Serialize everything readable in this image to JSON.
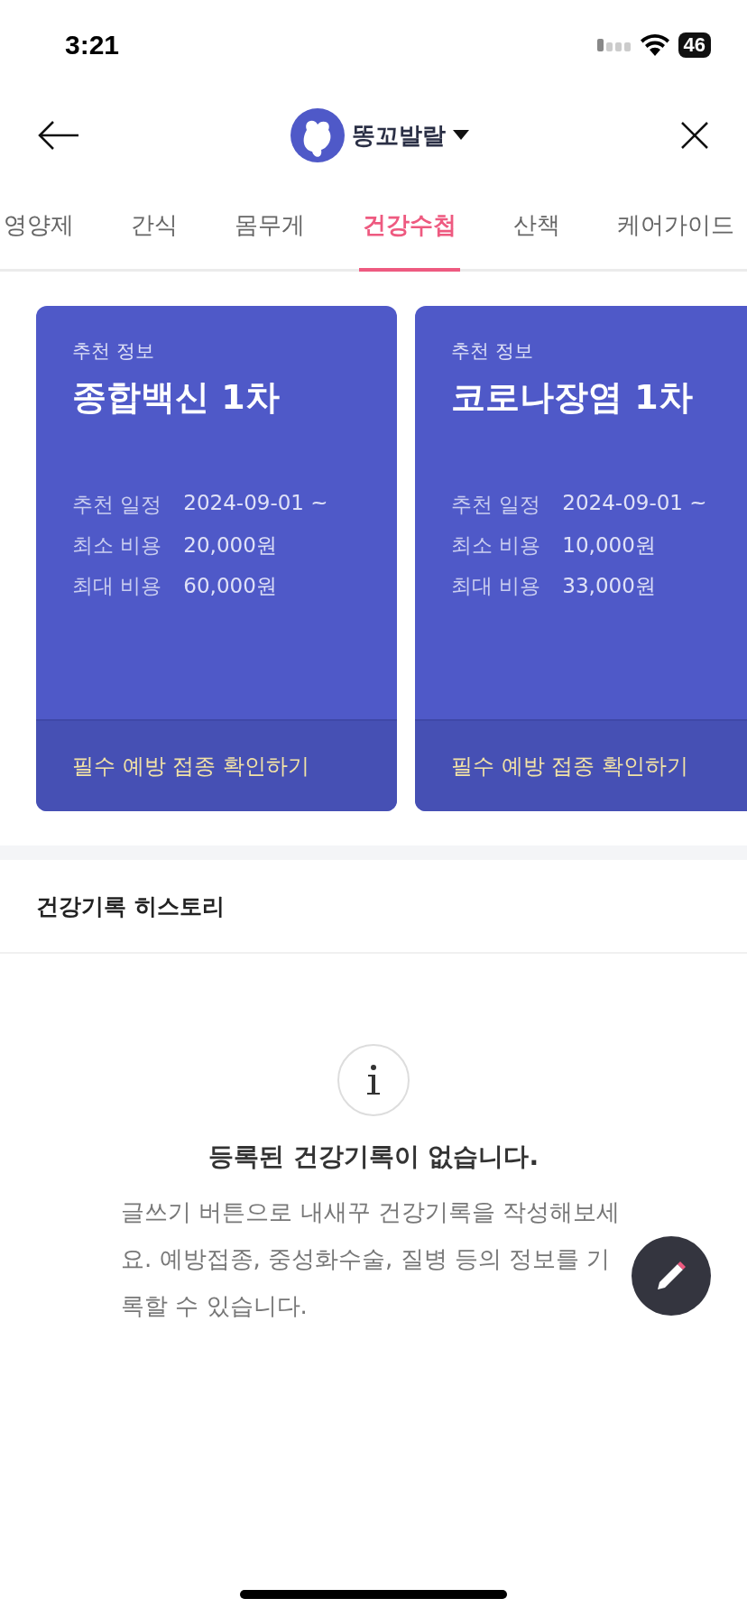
{
  "status_bar": {
    "time": "3:21",
    "battery": "46"
  },
  "header": {
    "pet_name": "똥꼬발랄"
  },
  "tabs": [
    {
      "label": "영양제",
      "selected": false
    },
    {
      "label": "간식",
      "selected": false
    },
    {
      "label": "몸무게",
      "selected": false
    },
    {
      "label": "건강수첩",
      "selected": true
    },
    {
      "label": "산책",
      "selected": false
    },
    {
      "label": "케어가이드",
      "selected": false
    }
  ],
  "cards": [
    {
      "label": "추천 정보",
      "title": "종합백신 1차",
      "rows": [
        {
          "label": "추천 일정",
          "value": "2024-09-01 ~"
        },
        {
          "label": "최소 비용",
          "value": "20,000원"
        },
        {
          "label": "최대 비용",
          "value": "60,000원"
        }
      ],
      "link": "필수 예방 접종 확인하기"
    },
    {
      "label": "추천 정보",
      "title": "코로나장염 1차",
      "rows": [
        {
          "label": "추천 일정",
          "value": "2024-09-01 ~"
        },
        {
          "label": "최소 비용",
          "value": "10,000원"
        },
        {
          "label": "최대 비용",
          "value": "33,000원"
        }
      ],
      "link": "필수 예방 접종 확인하기"
    }
  ],
  "history": {
    "title": "건강기록 히스토리",
    "empty_title": "등록된 건강기록이 없습니다.",
    "empty_text": "글쓰기 버튼으로 내새꾸 건강기록을 작성해보세요. 예방접종, 중성화수술, 질병 등의 정보를 기록할 수 있습니다."
  }
}
